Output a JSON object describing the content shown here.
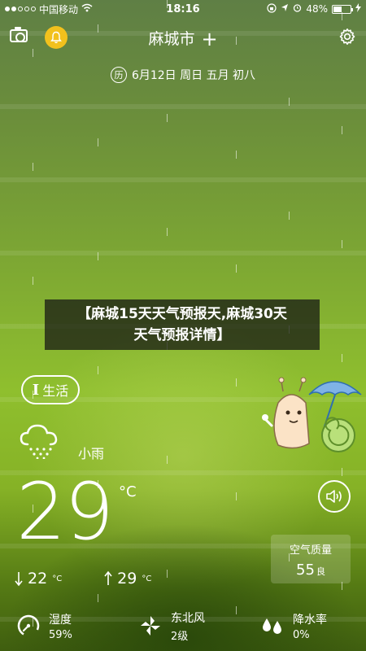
{
  "status_bar": {
    "carrier": "中国移动",
    "time": "18:16",
    "battery": "48%"
  },
  "header": {
    "city": "麻城市",
    "add_symbol": "+",
    "icons": [
      "camera-icon",
      "bell-icon",
      "gear-icon"
    ]
  },
  "date": {
    "badge": "历",
    "text": "6月12日 周日  五月 初八"
  },
  "banner": {
    "line1": "【麻城15天天气预报天,麻城30天",
    "line2": "天气预报详情】"
  },
  "life_button": {
    "prefix": "I",
    "label": "生活"
  },
  "weather": {
    "condition": "小雨",
    "temperature": "29",
    "unit": "°C",
    "low": "22",
    "high": "29",
    "range_unit": "°C"
  },
  "aqi": {
    "title": "空气质量",
    "value": "55",
    "level": "良"
  },
  "stats": [
    {
      "label": "湿度",
      "value": "59%",
      "icon": "humidity-gauge-icon"
    },
    {
      "label": "东北风",
      "value": "2级",
      "icon": "windmill-icon"
    },
    {
      "label": "降水率",
      "value": "0%",
      "icon": "raindrops-icon"
    }
  ],
  "colors": {
    "bell_bg": "#f2c11d",
    "banner_bg": "#141414"
  }
}
